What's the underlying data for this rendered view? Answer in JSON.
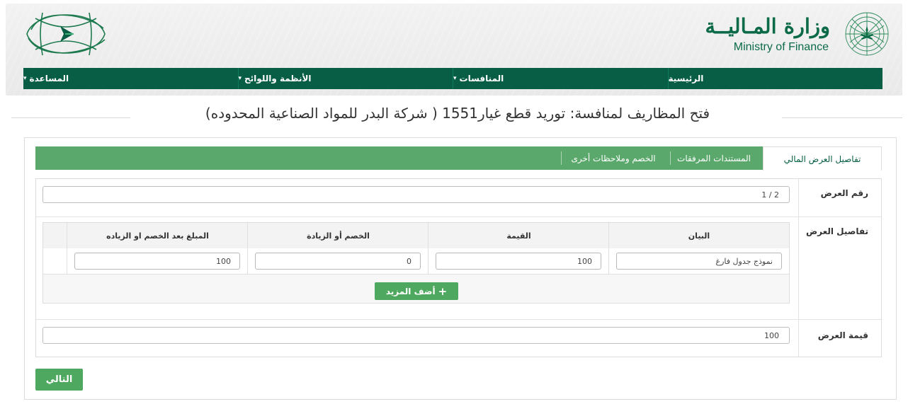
{
  "header": {
    "brand_ar": "وزارة المـاليــة",
    "brand_en": "Ministry of Finance",
    "colors": {
      "primary": "#075e44",
      "accent": "#4ea85f",
      "tab_bar": "#5aa86b"
    }
  },
  "nav": {
    "items": [
      {
        "label": "الرئيسية",
        "has_caret": false
      },
      {
        "label": "المنافسات",
        "has_caret": true
      },
      {
        "label": "الأنظمة واللوائح",
        "has_caret": true
      },
      {
        "label": "المساعدة",
        "has_caret": true
      }
    ],
    "caret_icon": "▾"
  },
  "page": {
    "title": "فتح المظاريف لمنافسة: توريد قطع غيار1551 ( شركة البدر للمواد الصناعية المحدوده)"
  },
  "tabs": [
    {
      "label": "تفاصيل العرض المالي",
      "active": true
    },
    {
      "label": "المستندات المرفقات",
      "active": false
    },
    {
      "label": "الخصم وملاحظات أخرى",
      "active": false
    }
  ],
  "form": {
    "offer_number": {
      "label": "رقم العرض",
      "value": "2 / 1"
    },
    "offer_details": {
      "label": "تفاصيل العرض",
      "columns": [
        "البيان",
        "القيمة",
        "الخصم أو الزيادة",
        "المبلغ بعد الخصم او الزياده"
      ],
      "rows": [
        {
          "description": "نموذج جدول فارغ",
          "value": "100",
          "adjustment": "0",
          "total": "100"
        }
      ],
      "add_more_label": "أضف المزيد",
      "add_icon": "+"
    },
    "offer_value": {
      "label": "قيمة العرض",
      "value": "100"
    }
  },
  "actions": {
    "next_label": "التالي"
  }
}
